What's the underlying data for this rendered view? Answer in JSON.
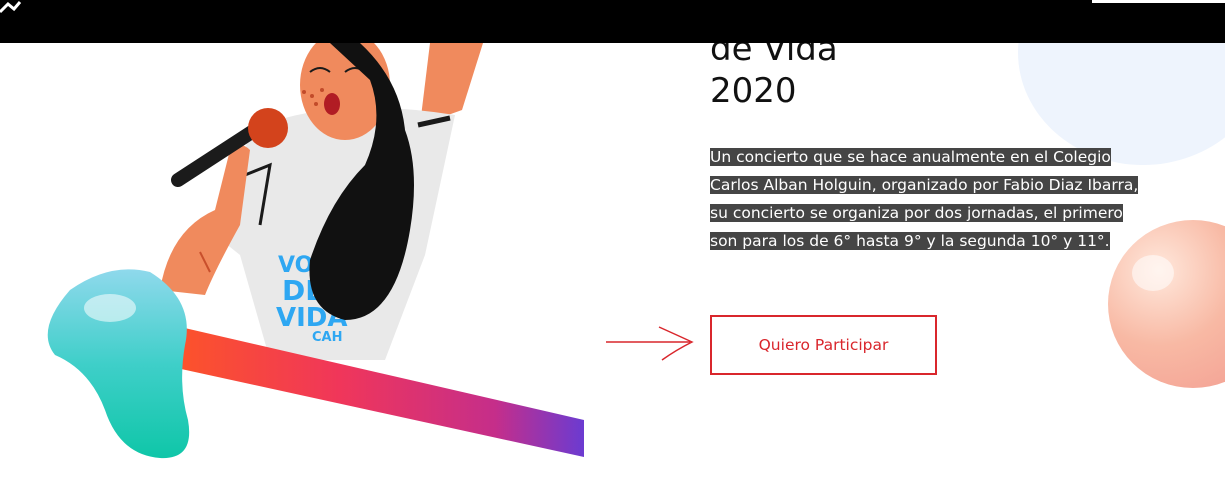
{
  "hero": {
    "title_line1": "de Vida",
    "title_line2": "2020",
    "description": "Un concierto que se hace anualmente en el Colegio Carlos Alban Holguin, organizado por Fabio Diaz Ibarra, su concierto se organiza por dos jornadas, el primero son para los de 6° hasta 9° y la segunda 10° y 11°.",
    "cta_label": "Quiero Participar"
  },
  "illustration": {
    "shirt_text_1": "VO",
    "shirt_text_2": "DE",
    "shirt_text_3": "VIDA",
    "shirt_text_4": "CAH"
  },
  "colors": {
    "accent": "#d9262c",
    "highlight_bg": "#454545",
    "topbar": "#000000"
  },
  "icons": {
    "arrow": "hand-drawn-arrow-right-icon"
  }
}
